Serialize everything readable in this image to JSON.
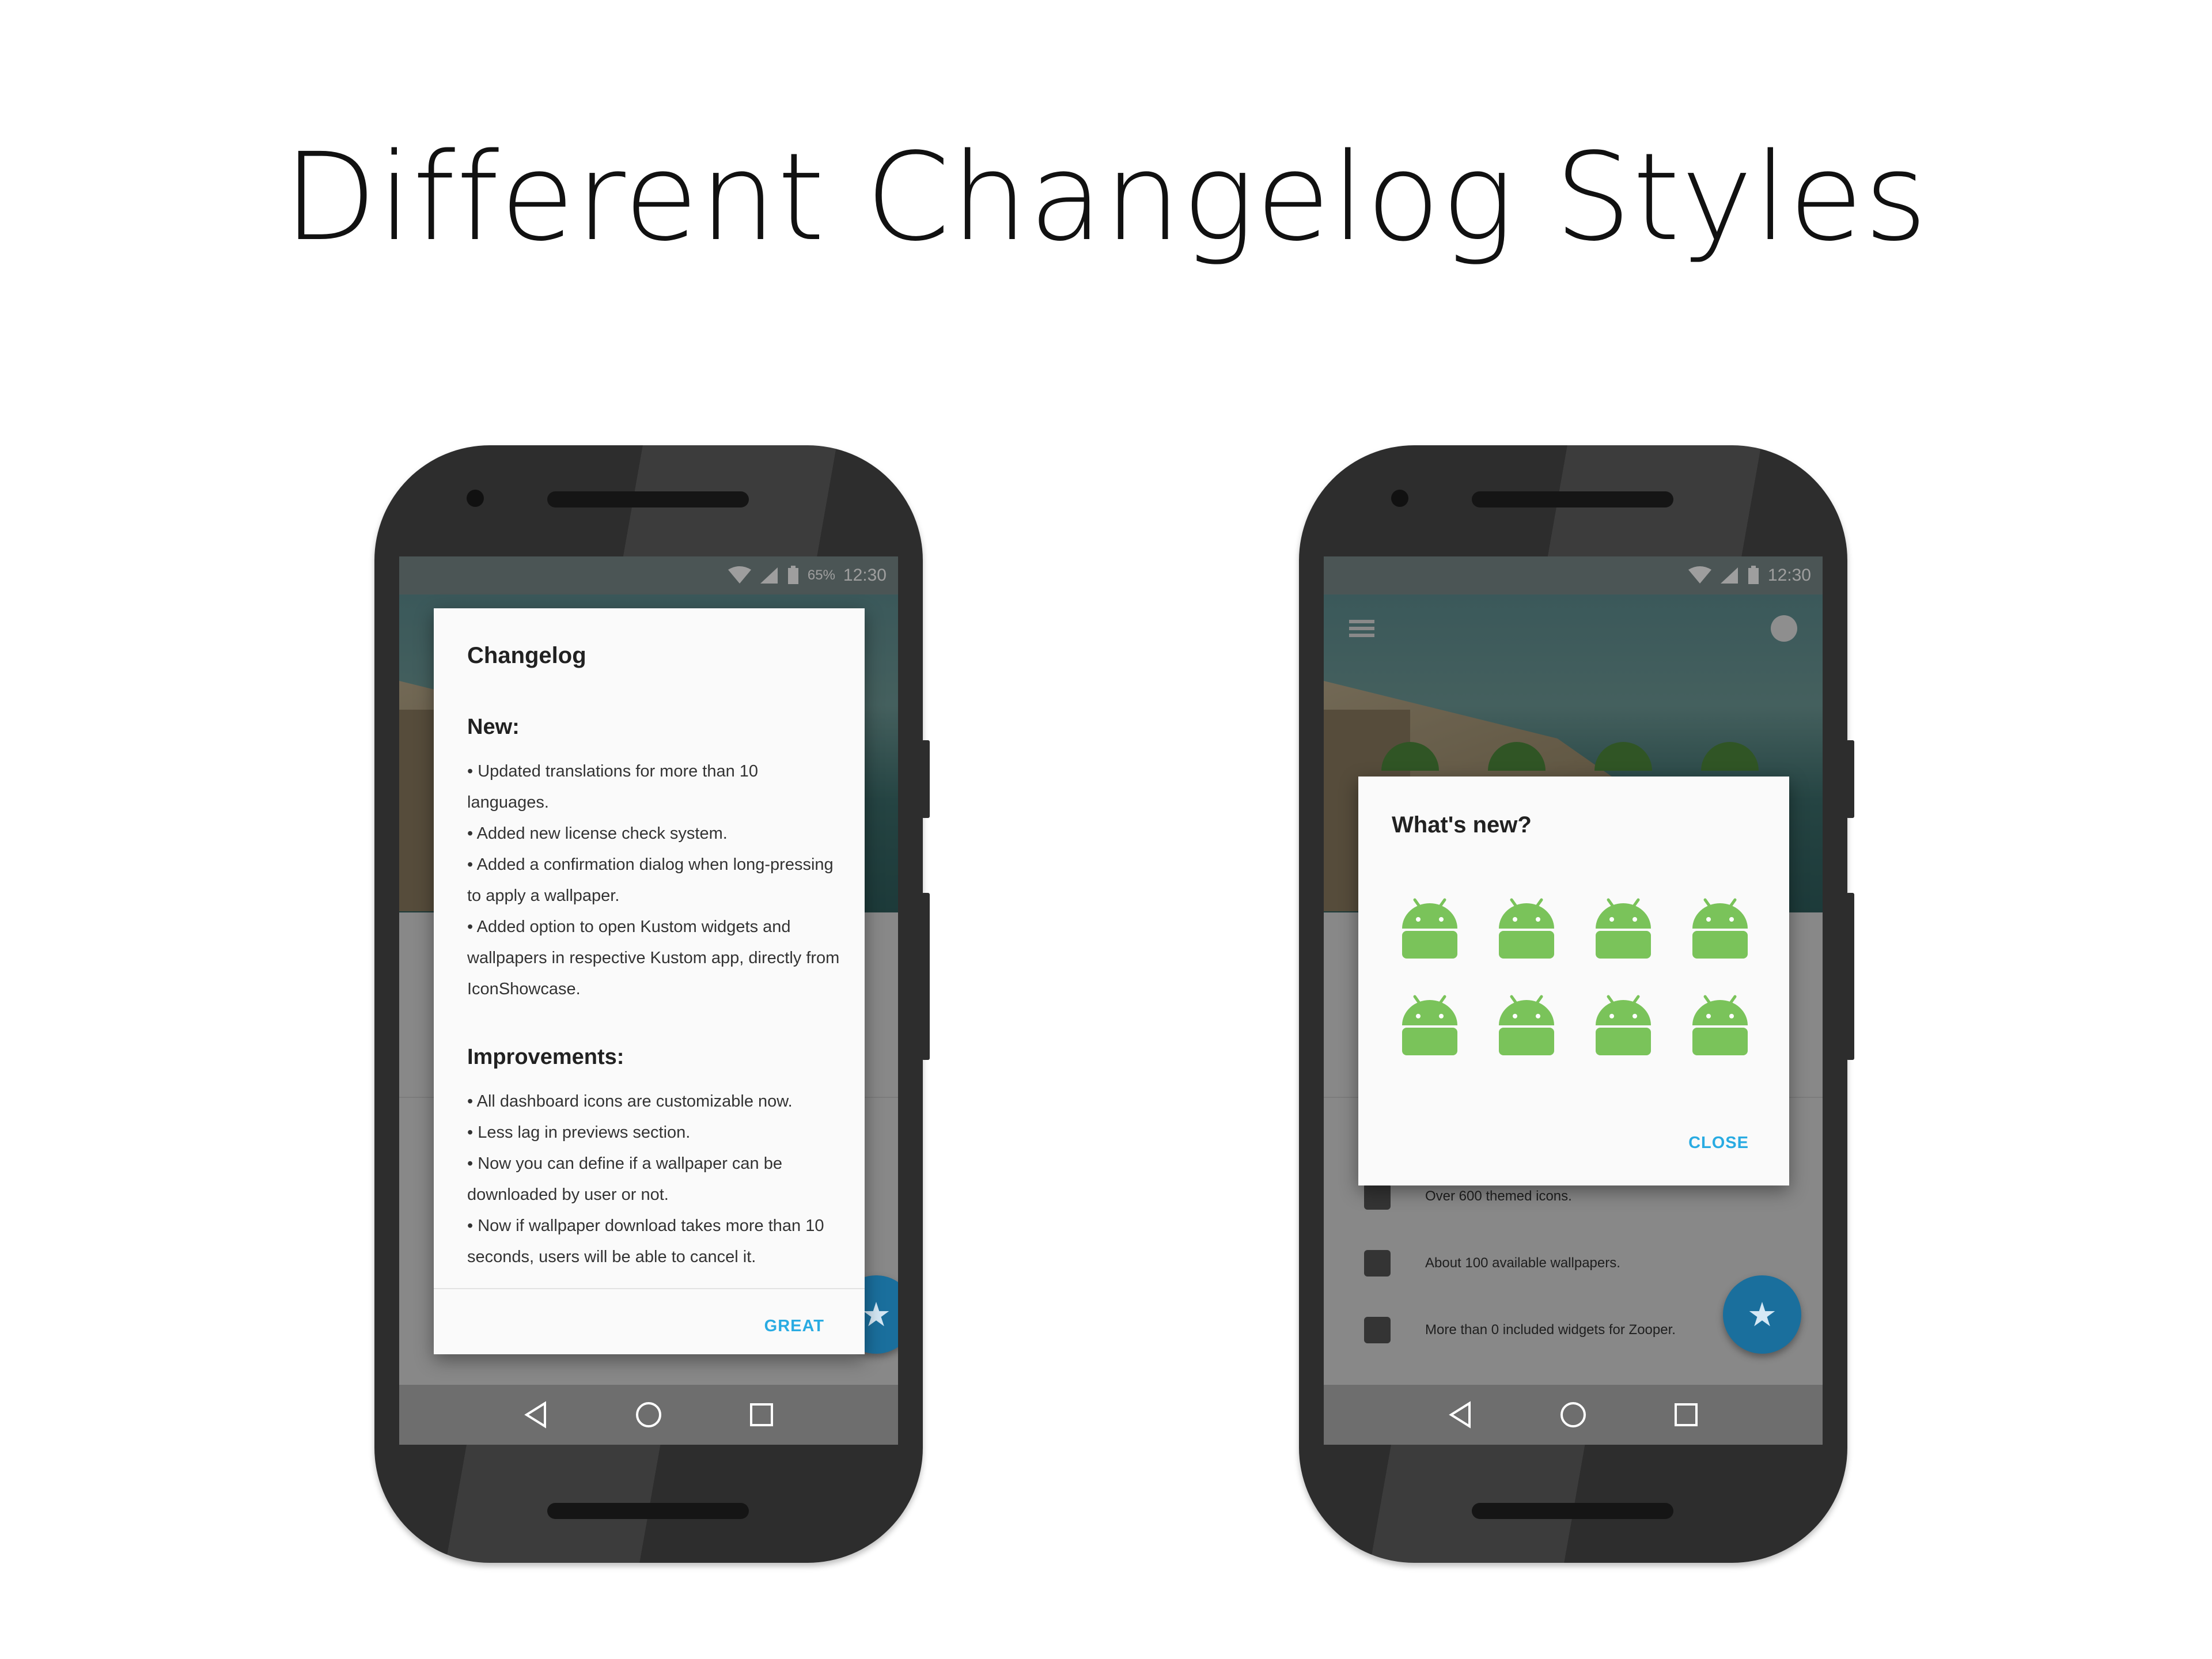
{
  "headline": "Different Changelog Styles",
  "status": {
    "battery_pct": "65%",
    "time": "12:30"
  },
  "left": {
    "dialog_title": "Changelog",
    "section_new": "New:",
    "new_items": [
      "• Updated translations for more than 10 languages.",
      "• Added new license check system.",
      "• Added a confirmation dialog when long-pressing to apply a wallpaper.",
      "• Added option to open Kustom widgets and wallpapers in respective Kustom app, directly from IconShowcase."
    ],
    "section_improvements": "Improvements:",
    "improvement_items": [
      "• All dashboard icons are customizable now.",
      "• Less lag in previews section.",
      "• Now you can define if a wallpaper can be downloaded by user or not.",
      "• Now if wallpaper download takes more than 10 seconds, users will be able to cancel it."
    ],
    "action": "GREAT"
  },
  "right": {
    "dialog_title": "What's new?",
    "action": "CLOSE",
    "features": [
      "Over 600 themed icons.",
      "About 100 available wallpapers.",
      "More than 0 included widgets for Zooper."
    ]
  },
  "icons": {
    "wifi": "wifi-icon",
    "signal": "signal-icon",
    "battery": "battery-icon",
    "back": "back-icon",
    "home": "home-icon",
    "recents": "recents-icon",
    "fab": "star-icon",
    "droid": "android-icon"
  },
  "colors": {
    "accent": "#29abe2",
    "fab": "#1a6f9d",
    "droid": "#7ac35a",
    "phone": "#2d2d2d"
  }
}
